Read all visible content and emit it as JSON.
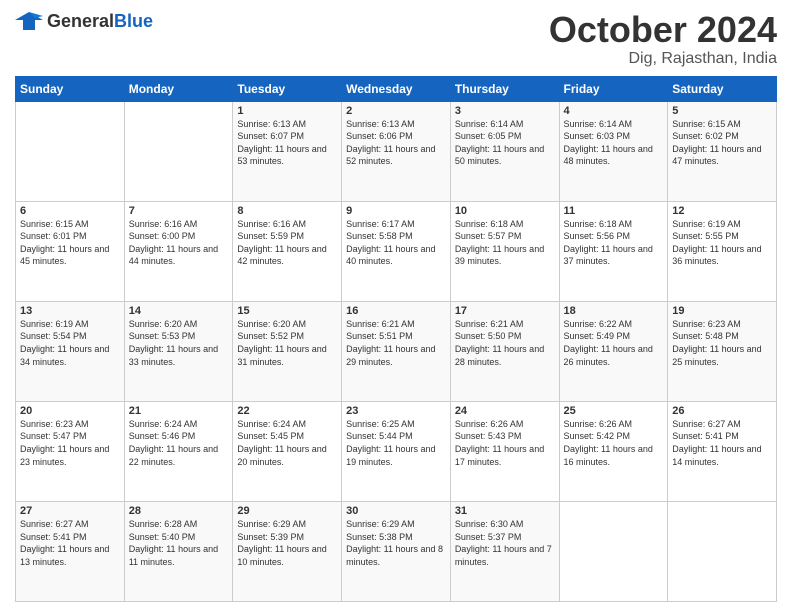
{
  "header": {
    "logo_general": "General",
    "logo_blue": "Blue",
    "month": "October 2024",
    "location": "Dig, Rajasthan, India"
  },
  "days_of_week": [
    "Sunday",
    "Monday",
    "Tuesday",
    "Wednesday",
    "Thursday",
    "Friday",
    "Saturday"
  ],
  "weeks": [
    [
      {
        "day": "",
        "info": ""
      },
      {
        "day": "",
        "info": ""
      },
      {
        "day": "1",
        "info": "Sunrise: 6:13 AM\nSunset: 6:07 PM\nDaylight: 11 hours and 53 minutes."
      },
      {
        "day": "2",
        "info": "Sunrise: 6:13 AM\nSunset: 6:06 PM\nDaylight: 11 hours and 52 minutes."
      },
      {
        "day": "3",
        "info": "Sunrise: 6:14 AM\nSunset: 6:05 PM\nDaylight: 11 hours and 50 minutes."
      },
      {
        "day": "4",
        "info": "Sunrise: 6:14 AM\nSunset: 6:03 PM\nDaylight: 11 hours and 48 minutes."
      },
      {
        "day": "5",
        "info": "Sunrise: 6:15 AM\nSunset: 6:02 PM\nDaylight: 11 hours and 47 minutes."
      }
    ],
    [
      {
        "day": "6",
        "info": "Sunrise: 6:15 AM\nSunset: 6:01 PM\nDaylight: 11 hours and 45 minutes."
      },
      {
        "day": "7",
        "info": "Sunrise: 6:16 AM\nSunset: 6:00 PM\nDaylight: 11 hours and 44 minutes."
      },
      {
        "day": "8",
        "info": "Sunrise: 6:16 AM\nSunset: 5:59 PM\nDaylight: 11 hours and 42 minutes."
      },
      {
        "day": "9",
        "info": "Sunrise: 6:17 AM\nSunset: 5:58 PM\nDaylight: 11 hours and 40 minutes."
      },
      {
        "day": "10",
        "info": "Sunrise: 6:18 AM\nSunset: 5:57 PM\nDaylight: 11 hours and 39 minutes."
      },
      {
        "day": "11",
        "info": "Sunrise: 6:18 AM\nSunset: 5:56 PM\nDaylight: 11 hours and 37 minutes."
      },
      {
        "day": "12",
        "info": "Sunrise: 6:19 AM\nSunset: 5:55 PM\nDaylight: 11 hours and 36 minutes."
      }
    ],
    [
      {
        "day": "13",
        "info": "Sunrise: 6:19 AM\nSunset: 5:54 PM\nDaylight: 11 hours and 34 minutes."
      },
      {
        "day": "14",
        "info": "Sunrise: 6:20 AM\nSunset: 5:53 PM\nDaylight: 11 hours and 33 minutes."
      },
      {
        "day": "15",
        "info": "Sunrise: 6:20 AM\nSunset: 5:52 PM\nDaylight: 11 hours and 31 minutes."
      },
      {
        "day": "16",
        "info": "Sunrise: 6:21 AM\nSunset: 5:51 PM\nDaylight: 11 hours and 29 minutes."
      },
      {
        "day": "17",
        "info": "Sunrise: 6:21 AM\nSunset: 5:50 PM\nDaylight: 11 hours and 28 minutes."
      },
      {
        "day": "18",
        "info": "Sunrise: 6:22 AM\nSunset: 5:49 PM\nDaylight: 11 hours and 26 minutes."
      },
      {
        "day": "19",
        "info": "Sunrise: 6:23 AM\nSunset: 5:48 PM\nDaylight: 11 hours and 25 minutes."
      }
    ],
    [
      {
        "day": "20",
        "info": "Sunrise: 6:23 AM\nSunset: 5:47 PM\nDaylight: 11 hours and 23 minutes."
      },
      {
        "day": "21",
        "info": "Sunrise: 6:24 AM\nSunset: 5:46 PM\nDaylight: 11 hours and 22 minutes."
      },
      {
        "day": "22",
        "info": "Sunrise: 6:24 AM\nSunset: 5:45 PM\nDaylight: 11 hours and 20 minutes."
      },
      {
        "day": "23",
        "info": "Sunrise: 6:25 AM\nSunset: 5:44 PM\nDaylight: 11 hours and 19 minutes."
      },
      {
        "day": "24",
        "info": "Sunrise: 6:26 AM\nSunset: 5:43 PM\nDaylight: 11 hours and 17 minutes."
      },
      {
        "day": "25",
        "info": "Sunrise: 6:26 AM\nSunset: 5:42 PM\nDaylight: 11 hours and 16 minutes."
      },
      {
        "day": "26",
        "info": "Sunrise: 6:27 AM\nSunset: 5:41 PM\nDaylight: 11 hours and 14 minutes."
      }
    ],
    [
      {
        "day": "27",
        "info": "Sunrise: 6:27 AM\nSunset: 5:41 PM\nDaylight: 11 hours and 13 minutes."
      },
      {
        "day": "28",
        "info": "Sunrise: 6:28 AM\nSunset: 5:40 PM\nDaylight: 11 hours and 11 minutes."
      },
      {
        "day": "29",
        "info": "Sunrise: 6:29 AM\nSunset: 5:39 PM\nDaylight: 11 hours and 10 minutes."
      },
      {
        "day": "30",
        "info": "Sunrise: 6:29 AM\nSunset: 5:38 PM\nDaylight: 11 hours and 8 minutes."
      },
      {
        "day": "31",
        "info": "Sunrise: 6:30 AM\nSunset: 5:37 PM\nDaylight: 11 hours and 7 minutes."
      },
      {
        "day": "",
        "info": ""
      },
      {
        "day": "",
        "info": ""
      }
    ]
  ]
}
